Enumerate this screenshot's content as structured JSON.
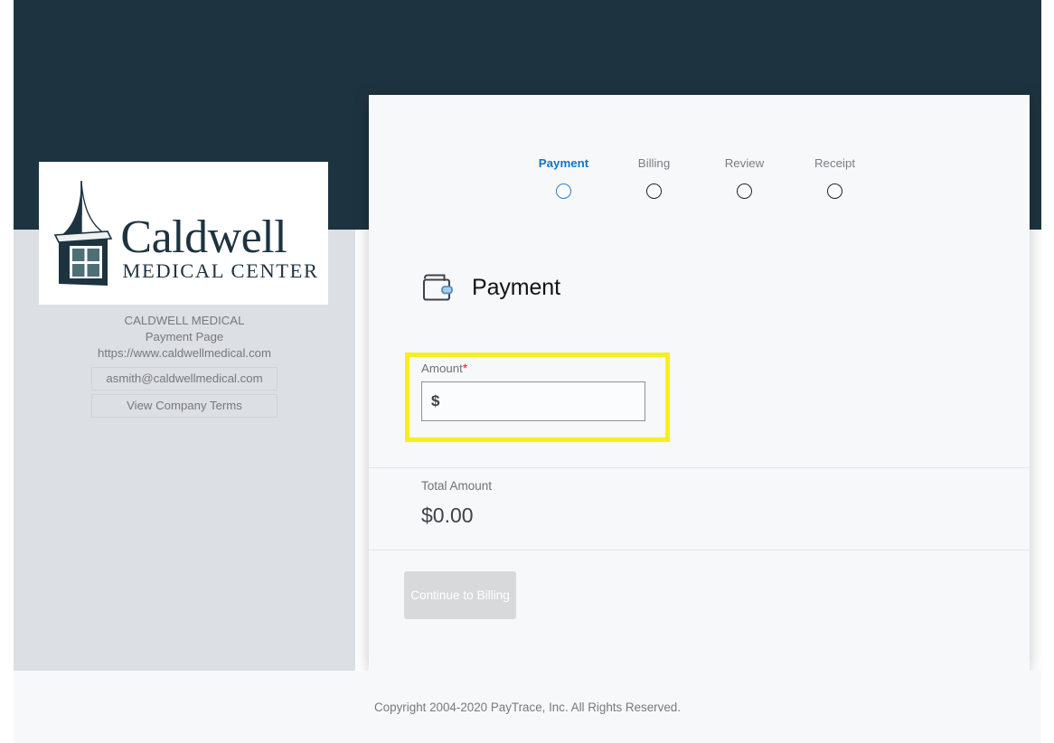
{
  "theme": {
    "header_navy": "#1e3340",
    "sidebar_gray": "#dcdfe3",
    "card_bg": "#f7f8fa",
    "accent_blue": "#1574c4",
    "highlight_yellow": "#f7ef1d",
    "required_red": "#e02020",
    "disabled_button": "#d8d9db"
  },
  "sidebar": {
    "logo": {
      "icon_name": "cupola-building-icon",
      "brand_name": "Caldwell",
      "brand_subtitle": "MEDICAL CENTER"
    },
    "merchant_name": "CALDWELL MEDICAL",
    "page_name": "Payment Page",
    "website": "https://www.caldwellmedical.com",
    "email_button_label": "asmith@caldwellmedical.com",
    "terms_button_label": "View Company Terms"
  },
  "stepper": {
    "steps": [
      {
        "label": "Payment",
        "active": true
      },
      {
        "label": "Billing",
        "active": false
      },
      {
        "label": "Review",
        "active": false
      },
      {
        "label": "Receipt",
        "active": false
      }
    ]
  },
  "main": {
    "section_icon": "wallet-icon",
    "section_title": "Payment",
    "amount": {
      "label": "Amount",
      "required_marker": "*",
      "value": "$",
      "placeholder": ""
    },
    "total": {
      "label": "Total Amount",
      "value": "$0.00"
    },
    "continue_button_label": "Continue to Billing"
  },
  "footer": {
    "copyright": "Copyright 2004-2020 PayTrace, Inc. All Rights Reserved."
  }
}
